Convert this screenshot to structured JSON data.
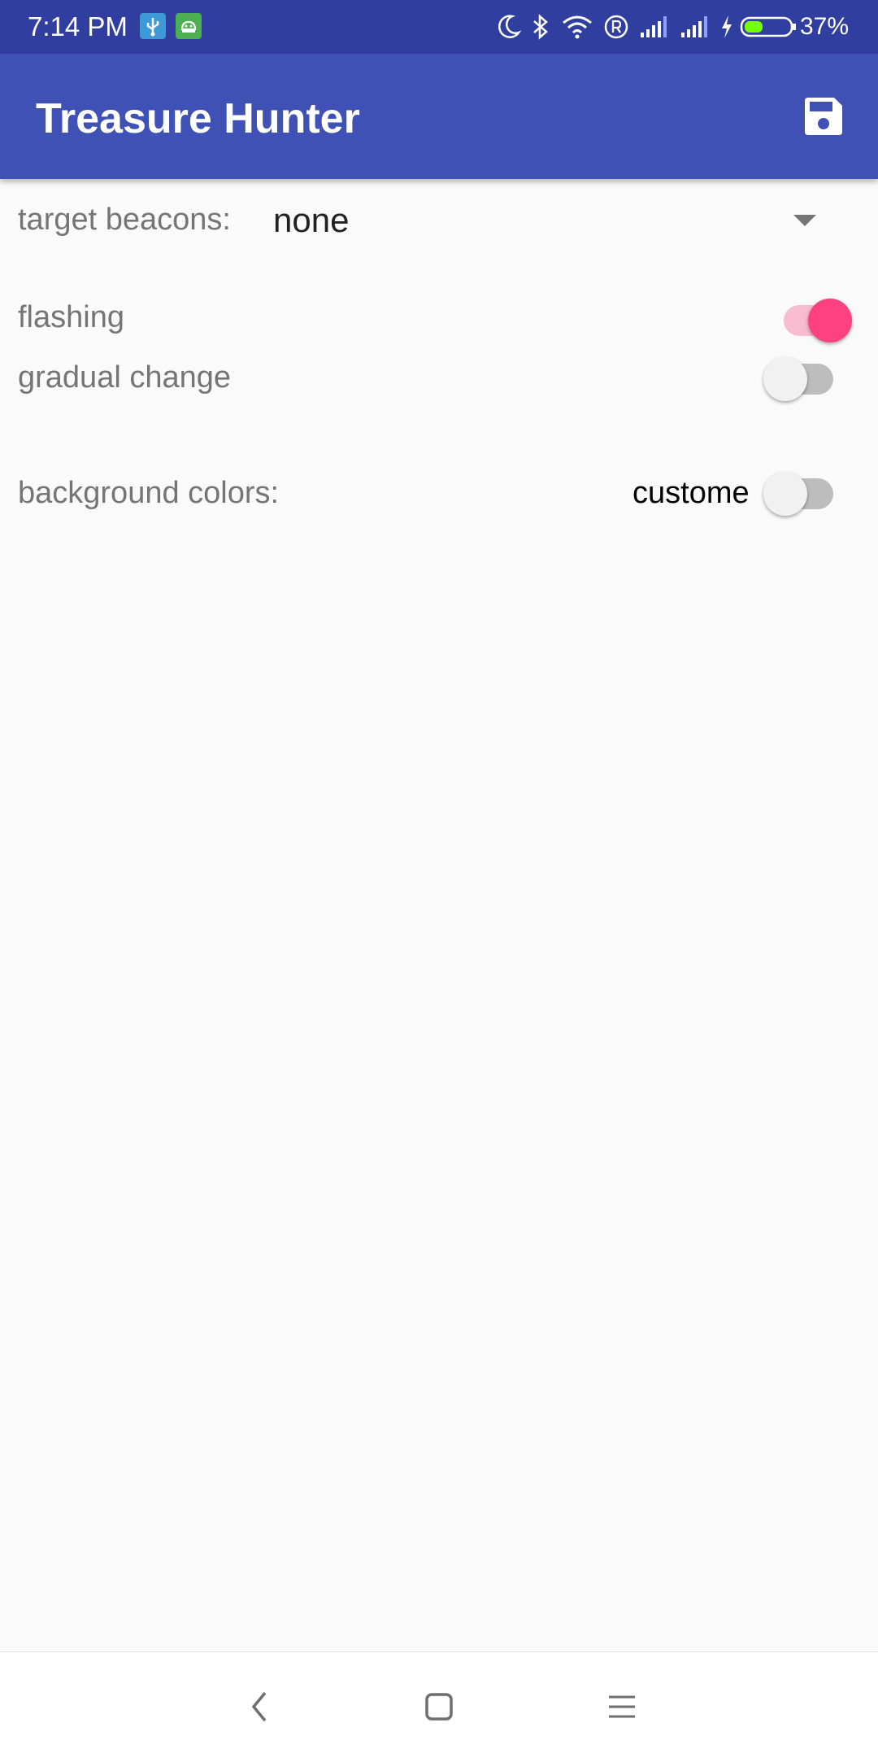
{
  "status_bar": {
    "time": "7:14 PM",
    "battery_text": "37%",
    "icons": [
      "usb-debug-icon",
      "android-icon",
      "moon-icon",
      "bluetooth-icon",
      "wifi-icon",
      "registered-icon",
      "signal-icon",
      "signal-icon",
      "charging-icon",
      "battery-icon"
    ]
  },
  "app_bar": {
    "title": "Treasure Hunter",
    "action_icon": "save-icon"
  },
  "settings": {
    "target_beacons": {
      "label": "target beacons:",
      "value": "none"
    },
    "flashing": {
      "label": "flashing",
      "checked": true
    },
    "gradual_change": {
      "label": "gradual change",
      "checked": false
    },
    "background_colors": {
      "label": "background colors:",
      "switch_text": "custome",
      "checked": false
    }
  },
  "colors": {
    "status_bar": "#303f9f",
    "app_bar": "#3f51b5",
    "accent": "#ff4081",
    "background": "#fafafa"
  },
  "nav_bar": {
    "icons": [
      "back-icon",
      "home-icon",
      "menu-icon"
    ]
  }
}
